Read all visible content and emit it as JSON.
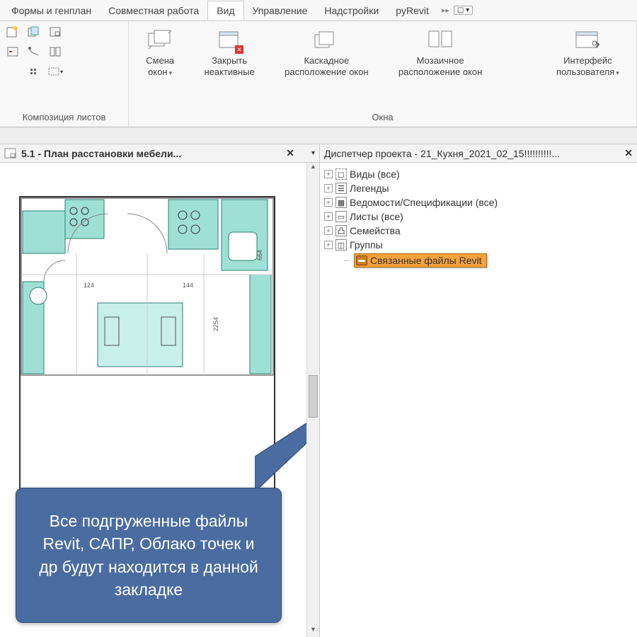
{
  "tabs": [
    "Формы и генплан",
    "Совместная работа",
    "Вид",
    "Управление",
    "Надстройки",
    "pyRevit"
  ],
  "activeTab": 2,
  "panels": {
    "composition": {
      "label": "Композиция листов"
    },
    "windows": {
      "label": "Окна",
      "switch": {
        "line1": "Смена",
        "line2": "окон"
      },
      "close_inactive": {
        "line1": "Закрыть",
        "line2": "неактивные"
      },
      "cascade": {
        "line1": "Каскадное",
        "line2": "расположение окон"
      },
      "tile": {
        "line1": "Мозаичное",
        "line2": "расположение окон"
      },
      "ui": {
        "line1": "Интерфейс",
        "line2": "пользователя"
      }
    }
  },
  "leftTab": {
    "title": "5.1 - План расстановки мебели..."
  },
  "rightTab": {
    "title": "Диспетчер проекта - 21_Кухня_2021_02_15!!!!!!!!!!..."
  },
  "tree": {
    "items": [
      "Виды (все)",
      "Легенды",
      "Ведомости/Спецификации (все)",
      "Листы (все)",
      "Семейства",
      "Группы"
    ],
    "highlight": "Связанные файлы Revit"
  },
  "callout": "Все подгруженные файлы Revit, САПР, Облако точек и др будут находится в данной закладке",
  "plan": {
    "d1": "124",
    "d2": "144",
    "d3": "2254",
    "d4": "664"
  }
}
